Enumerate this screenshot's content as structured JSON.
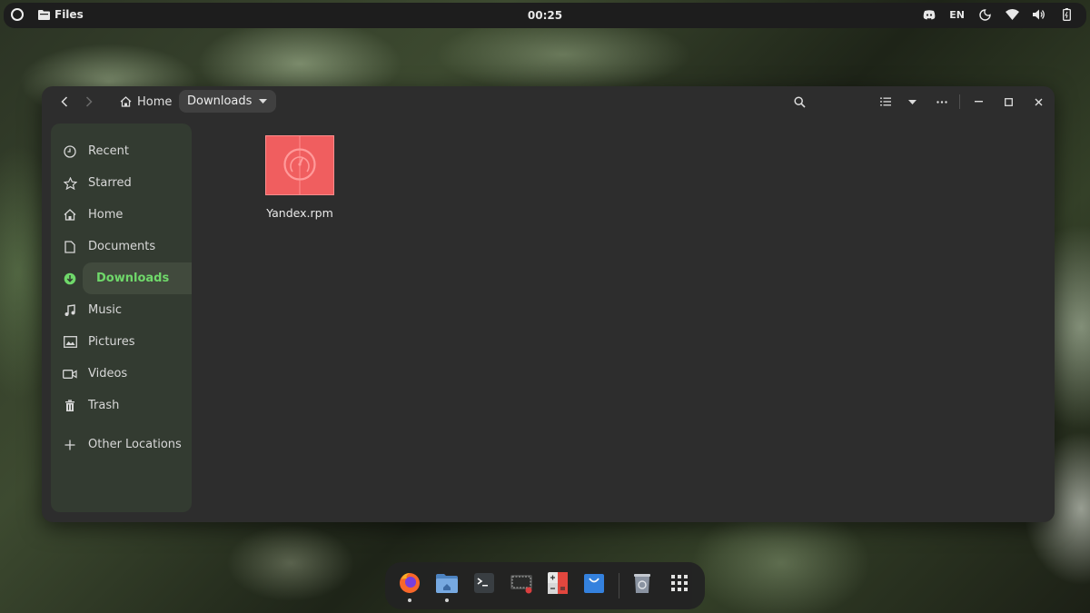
{
  "topbar": {
    "app_name": "Files",
    "clock": "00:25",
    "language": "EN",
    "tray_icons": [
      "discord-icon",
      "night-light-icon",
      "wifi-icon",
      "volume-icon",
      "battery-icon"
    ]
  },
  "header": {
    "breadcrumb_home": "Home",
    "breadcrumb_current": "Downloads"
  },
  "sidebar": {
    "items": [
      {
        "label": "Recent",
        "icon": "clock-icon"
      },
      {
        "label": "Starred",
        "icon": "star-icon"
      },
      {
        "label": "Home",
        "icon": "home-icon"
      },
      {
        "label": "Documents",
        "icon": "document-icon"
      },
      {
        "label": "Downloads",
        "icon": "download-icon",
        "active": true
      },
      {
        "label": "Music",
        "icon": "music-icon"
      },
      {
        "label": "Pictures",
        "icon": "pictures-icon"
      },
      {
        "label": "Videos",
        "icon": "video-icon"
      },
      {
        "label": "Trash",
        "icon": "trash-icon"
      },
      {
        "label": "Other Locations",
        "icon": "plus-icon"
      }
    ]
  },
  "files": [
    {
      "name": "Yandex.rpm",
      "icon": "yandex-package-icon"
    }
  ],
  "dock": {
    "apps": [
      "firefox",
      "files",
      "terminal",
      "screenshot-tool",
      "calculator",
      "software-store",
      "trash",
      "app-grid"
    ]
  },
  "colors": {
    "accent": "#6fd86a",
    "window_bg": "#2d2d2d",
    "sidebar_bg": "#333b31",
    "file_icon": "#f05e5f"
  }
}
